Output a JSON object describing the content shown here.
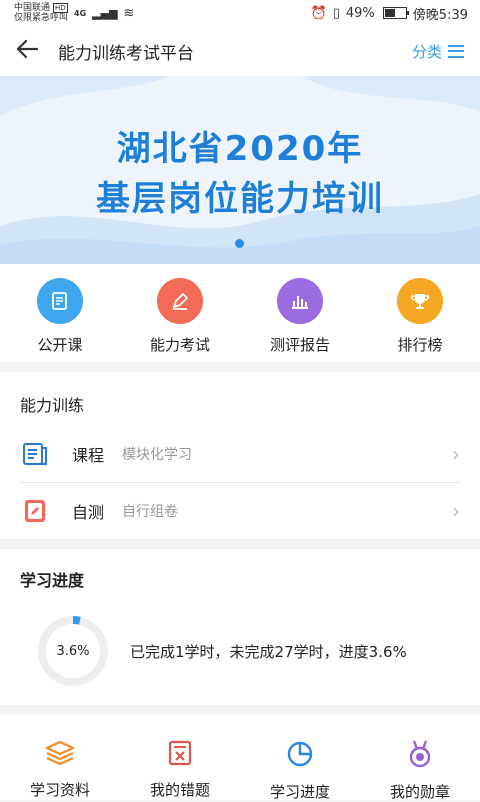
{
  "status_bar": {
    "carrier_line1": "中国联通",
    "hd_badge": "HD",
    "network": "4G",
    "carrier_line2": "仅限紧急呼叫",
    "battery": "49%",
    "time": "傍晚5:39"
  },
  "header": {
    "title": "能力训练考试平台",
    "category_label": "分类"
  },
  "banner": {
    "line1": "湖北省2020年",
    "line2": "基层岗位能力培训"
  },
  "quick_links": [
    {
      "label": "公开课",
      "icon": "notebook-icon",
      "color": "#3ea5ee"
    },
    {
      "label": "能力考试",
      "icon": "pen-icon",
      "color": "#f26b54"
    },
    {
      "label": "测评报告",
      "icon": "bar-chart-icon",
      "color": "#9b6be0"
    },
    {
      "label": "排行榜",
      "icon": "trophy-icon",
      "color": "#f5a623"
    }
  ],
  "training": {
    "title": "能力训练",
    "items": [
      {
        "title": "课程",
        "desc": "模块化学习",
        "icon": "course-book-icon"
      },
      {
        "title": "自测",
        "desc": "自行组卷",
        "icon": "self-test-icon"
      }
    ]
  },
  "progress": {
    "title": "学习进度",
    "percent_label": "3.6%",
    "percent": 3.6,
    "summary": "已完成1学时，未完成27学时，进度3.6%"
  },
  "bottom_nav": [
    {
      "label": "学习资料",
      "icon": "stack-layers-icon"
    },
    {
      "label": "我的错题",
      "icon": "wrong-question-icon"
    },
    {
      "label": "学习进度",
      "icon": "pie-chart-icon"
    },
    {
      "label": "我的勋章",
      "icon": "medal-icon"
    }
  ],
  "colors": {
    "accent": "#3a9be8",
    "banner_text": "#1e7fd8"
  }
}
